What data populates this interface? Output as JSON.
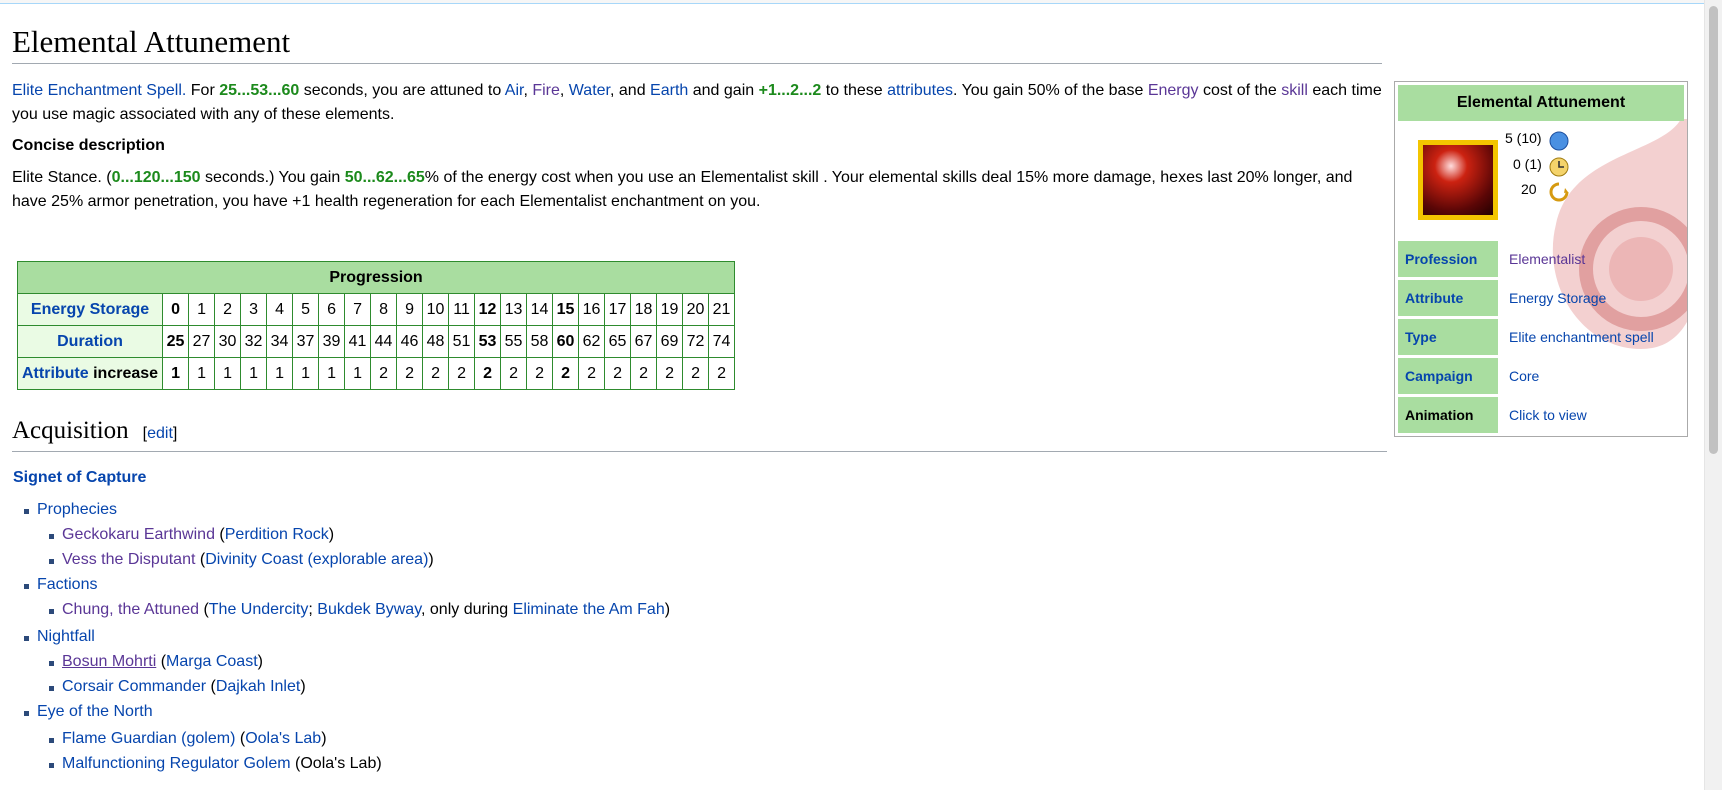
{
  "page": {
    "title": "Elemental Attunement",
    "intro": {
      "elite_spell": "Elite Enchantment Spell.",
      "for": "For",
      "duration_range": "25...53...60",
      "seconds_attuned": "seconds, you are attuned to",
      "air": "Air",
      "fire": "Fire",
      "water": "Water",
      "and": ", and",
      "earth": "Earth",
      "and_gain": "and gain",
      "attr_gain": "+1...2...2",
      "to_these": "to these",
      "attributes": "attributes",
      "gain_text": ". You gain 50% of the base",
      "energy": "Energy",
      "cost_of_the": "cost of the",
      "skill": "skill",
      "tail": "each time you use magic associated with any of these elements."
    },
    "concise_heading": "Concise description",
    "concise": {
      "elite_stance": "Elite Stance.",
      "open": "(",
      "dur_range": "0...120...150",
      "dur_tail": "seconds.) You gain",
      "pct_range": "50...62...65",
      "rest": "% of the energy cost when you use an Elementalist skill . Your elemental skills deal 15% more damage, hexes last 20% longer, and have 25% armor penetration, you have +1 health regeneration for each Elementalist enchantment on you."
    },
    "progression": {
      "caption": "Progression",
      "energy_storage_label": "Energy Storage",
      "duration_label": "Duration",
      "attribute_label": "Attribute",
      "increase_label": "increase",
      "levels": [
        "0",
        "1",
        "2",
        "3",
        "4",
        "5",
        "6",
        "7",
        "8",
        "9",
        "10",
        "11",
        "12",
        "13",
        "14",
        "15",
        "16",
        "17",
        "18",
        "19",
        "20",
        "21"
      ],
      "duration": [
        "25",
        "27",
        "30",
        "32",
        "34",
        "37",
        "39",
        "41",
        "44",
        "46",
        "48",
        "51",
        "53",
        "55",
        "58",
        "60",
        "62",
        "65",
        "67",
        "69",
        "72",
        "74"
      ],
      "attribute_increase": [
        "1",
        "1",
        "1",
        "1",
        "1",
        "1",
        "1",
        "1",
        "2",
        "2",
        "2",
        "2",
        "2",
        "2",
        "2",
        "2",
        "2",
        "2",
        "2",
        "2",
        "2",
        "2"
      ]
    },
    "acquisition": {
      "heading": "Acquisition",
      "edit_open": "[",
      "edit": "edit",
      "edit_close": "]",
      "signet": "Signet of Capture",
      "prophecies": "Prophecies",
      "geckokaru": "Geckokaru Earthwind",
      "perdition": "Perdition Rock",
      "vess": "Vess the Disputant",
      "divinity": "Divinity Coast (explorable area)",
      "factions": "Factions",
      "chung": "Chung, the Attuned",
      "undercity": "The Undercity",
      "bukdek": "Bukdek Byway",
      "only_during": ", only during",
      "eliminate": "Eliminate the Am Fah",
      "nightfall": "Nightfall",
      "bosun": "Bosun Mohrti",
      "marga": "Marga Coast",
      "corsair": "Corsair Commander",
      "dajkah": "Dajkah Inlet",
      "eotn": "Eye of the North",
      "flame_guardian": "Flame Guardian (golem)",
      "oola_lab": "Oola's Lab",
      "malfunction": "Malfunctioning Regulator Golem",
      "oola_plain": "(Oola's Lab)"
    },
    "infobox": {
      "title": "Elemental Attunement",
      "energy_cost": "5 (10)",
      "activation": "0 (1)",
      "recharge": "20",
      "rows": [
        {
          "key": "Profession",
          "value": "Elementalist"
        },
        {
          "key": "Attribute",
          "value": "Energy Storage"
        },
        {
          "key": "Type",
          "value": "Elite enchantment spell"
        },
        {
          "key": "Campaign",
          "value": "Core"
        },
        {
          "key": "Animation",
          "value": "Click to view"
        }
      ]
    }
  },
  "colors": {
    "link": "#0645ad",
    "visited": "#5a3696",
    "green_value": "#1c8a1c",
    "table_header": "#a9dda0",
    "table_border": "#2e8b2e"
  }
}
